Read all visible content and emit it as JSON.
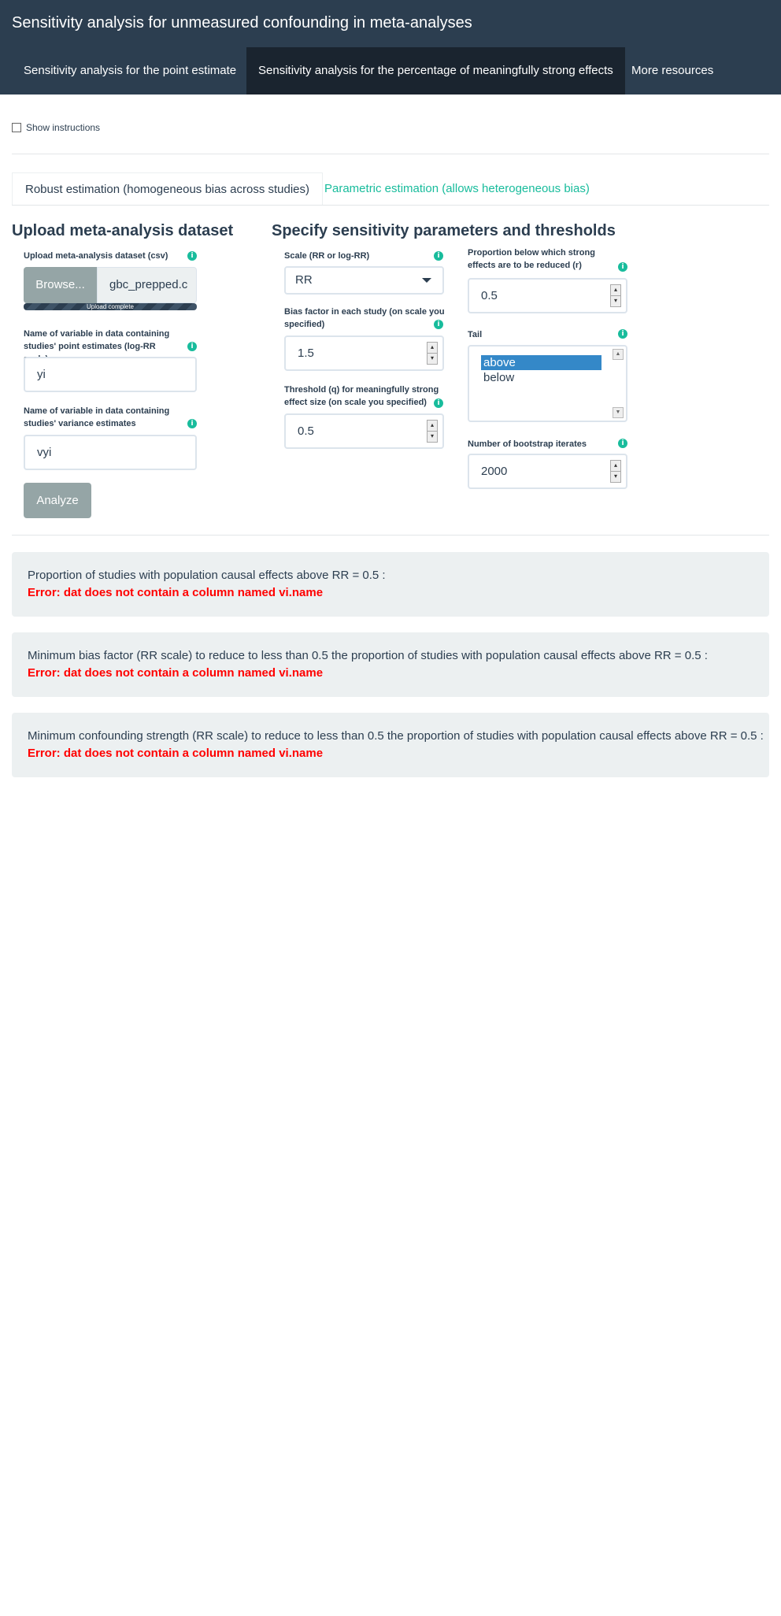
{
  "navbar": {
    "brand": "Sensitivity analysis for unmeasured confounding in meta-analyses",
    "tabs": [
      {
        "label": "Sensitivity analysis for the point estimate"
      },
      {
        "label": "Sensitivity analysis for the percentage of meaningfully strong effects"
      },
      {
        "label": "More resources"
      }
    ]
  },
  "instructions": {
    "label": "Show instructions",
    "checked": false
  },
  "subtabs": [
    {
      "label": "Robust estimation (homogeneous bias across studies)"
    },
    {
      "label": "Parametric estimation (allows heterogeneous bias)"
    }
  ],
  "upload": {
    "heading": "Upload meta-analysis dataset",
    "file_label": "Upload meta-analysis dataset (csv)",
    "browse_label": "Browse...",
    "filename": "gbc_prepped.c",
    "progress_text": "Upload complete",
    "progress_fraction": 1.0,
    "yi_label": "Name of variable in data containing studies' point estimates (log-RR scale)",
    "yi_value": "yi",
    "vi_label": "Name of variable in data containing studies' variance estimates",
    "vi_value": "vyi",
    "analyze_label": "Analyze"
  },
  "params": {
    "heading": "Specify sensitivity parameters and thresholds",
    "scale_label": "Scale (RR or log-RR)",
    "scale_value": "RR",
    "bias_label": "Bias factor in each study (on scale you specified)",
    "bias_value": "1.5",
    "q_label": "Threshold (q) for meaningfully strong effect size (on scale you specified)",
    "q_value": "0.5",
    "r_label": "Proportion below which strong effects are to be reduced (r)",
    "r_value": "0.5",
    "tail_label": "Tail",
    "tail_options": [
      "above",
      "below"
    ],
    "tail_selected": "above",
    "boot_label": "Number of bootstrap iterates",
    "boot_value": "2000"
  },
  "results": [
    {
      "title": "Proportion of studies with population causal effects above RR = 0.5 :",
      "error": "Error: dat does not contain a column named vi.name"
    },
    {
      "title": "Minimum bias factor (RR scale) to reduce to less than 0.5 the proportion of studies with population causal effects above RR = 0.5 :",
      "error": "Error: dat does not contain a column named vi.name"
    },
    {
      "title": "Minimum confounding strength (RR scale) to reduce to less than 0.5 the proportion of studies with population causal effects above RR = 0.5 :",
      "error": "Error: dat does not contain a column named vi.name"
    }
  ],
  "colors": {
    "navbar": "#2c3e50",
    "active_tab": "#1a242f",
    "accent": "#18bc9c",
    "error": "#ff0000",
    "well": "#ecf0f1"
  }
}
